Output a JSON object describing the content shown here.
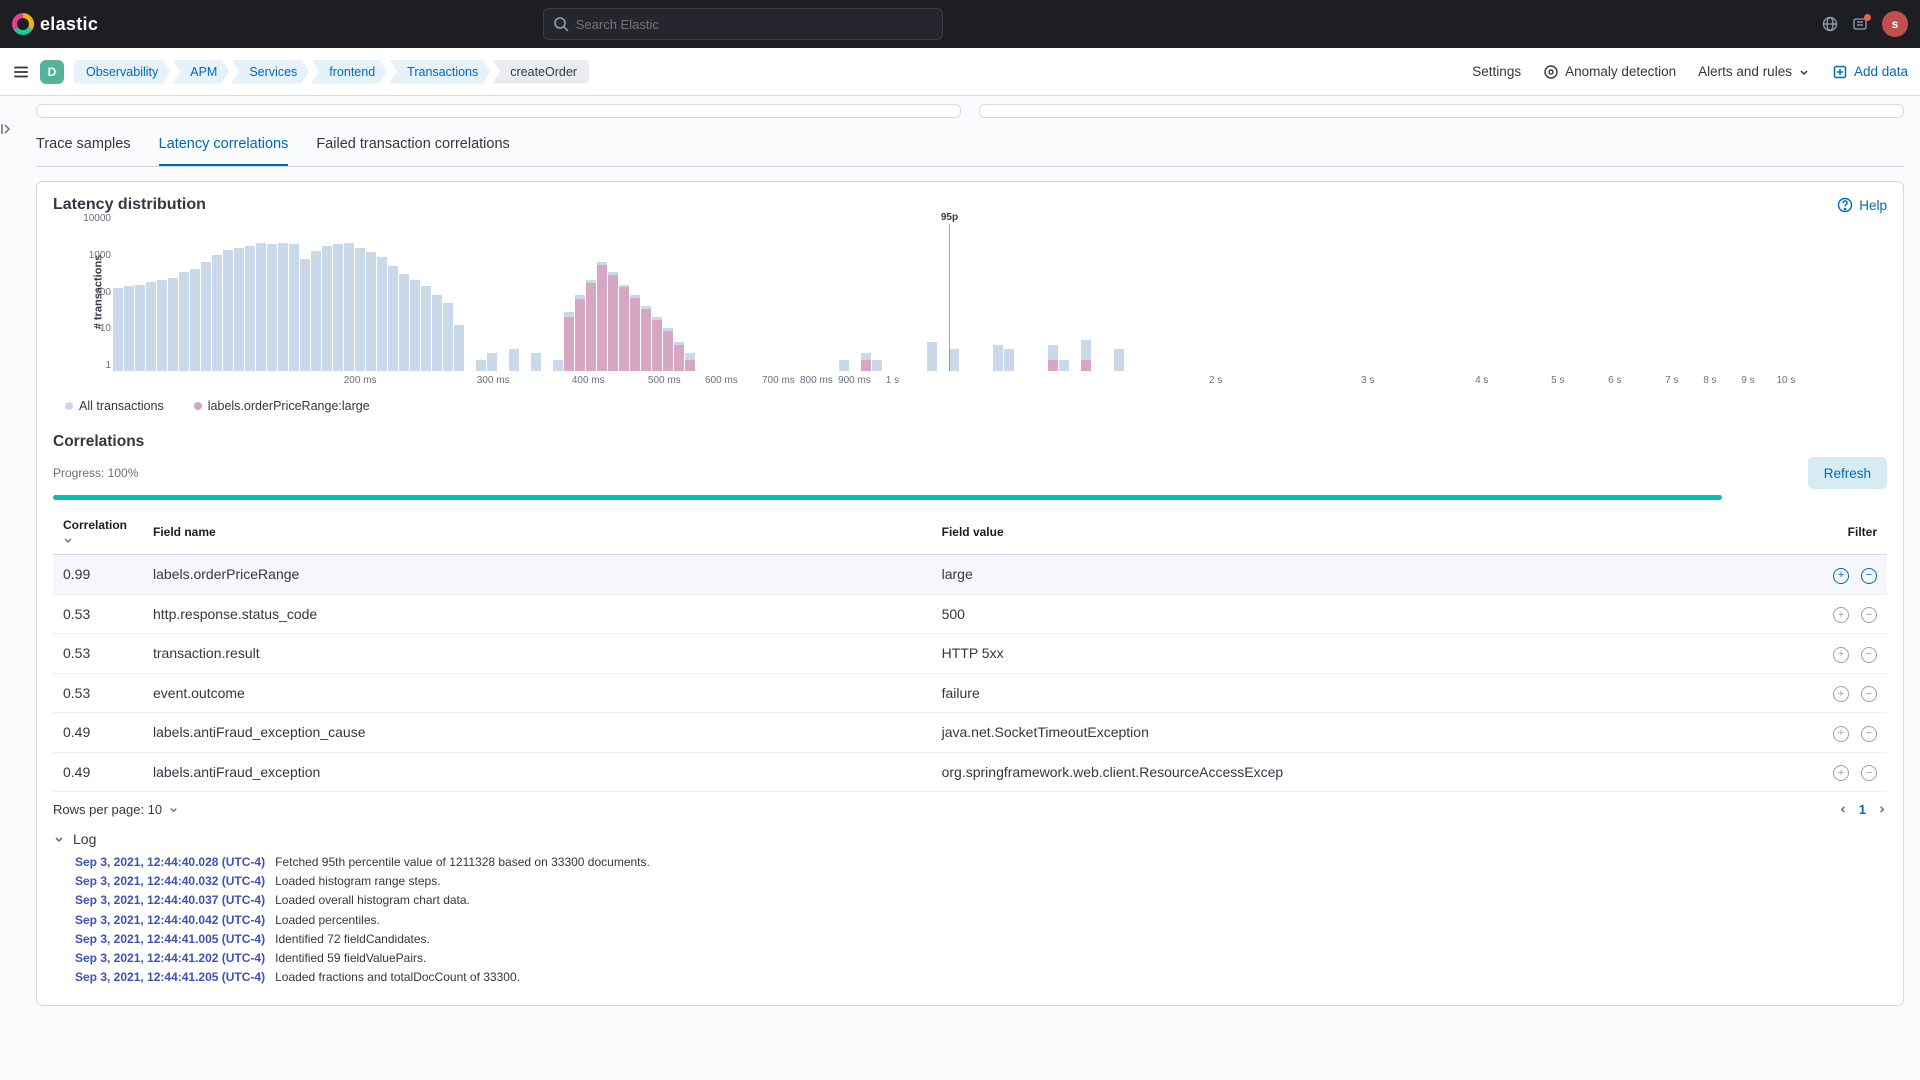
{
  "brand": "elastic",
  "search_placeholder": "Search Elastic",
  "avatar_initial": "s",
  "breadcrumbs": [
    "Observability",
    "APM",
    "Services",
    "frontend",
    "Transactions",
    "createOrder"
  ],
  "subnav": {
    "settings": "Settings",
    "anomaly": "Anomaly detection",
    "alerts": "Alerts and rules",
    "add": "Add data"
  },
  "tabs": {
    "samples": "Trace samples",
    "latency": "Latency correlations",
    "failed": "Failed transaction correlations"
  },
  "panel": {
    "title": "Latency distribution",
    "help": "Help",
    "p95": "95p"
  },
  "legend": {
    "all": "All transactions",
    "sel": "labels.orderPriceRange:large",
    "all_color": "#c9d9ea",
    "sel_color": "#d6a6c2"
  },
  "chart_data": {
    "type": "bar",
    "xlabel": "",
    "ylabel": "# transactions",
    "yticks": [
      "1",
      "10",
      "100",
      "1000",
      "10000"
    ],
    "ylim": [
      1,
      10000
    ],
    "p95_index": 44,
    "xticks": [
      {
        "pos": 13,
        "label": "200 ms"
      },
      {
        "pos": 20,
        "label": "300 ms"
      },
      {
        "pos": 25,
        "label": "400 ms"
      },
      {
        "pos": 29,
        "label": "500 ms"
      },
      {
        "pos": 32,
        "label": "600 ms"
      },
      {
        "pos": 35,
        "label": "700 ms"
      },
      {
        "pos": 37,
        "label": "800 ms"
      },
      {
        "pos": 39,
        "label": "900 ms"
      },
      {
        "pos": 41,
        "label": "1 s"
      },
      {
        "pos": 58,
        "label": "2 s"
      },
      {
        "pos": 66,
        "label": "3 s"
      },
      {
        "pos": 72,
        "label": "4 s"
      },
      {
        "pos": 76,
        "label": "5 s"
      },
      {
        "pos": 79,
        "label": "6 s"
      },
      {
        "pos": 82,
        "label": "7 s"
      },
      {
        "pos": 84,
        "label": "8 s"
      },
      {
        "pos": 86,
        "label": "9 s"
      },
      {
        "pos": 88,
        "label": "10 s"
      }
    ],
    "series": [
      {
        "name": "All transactions",
        "color": "#c9d9ea",
        "values": [
          180,
          200,
          220,
          260,
          300,
          350,
          480,
          600,
          900,
          1400,
          2000,
          2200,
          2600,
          3000,
          2900,
          3100,
          2800,
          1100,
          1800,
          2500,
          2800,
          3000,
          2200,
          1700,
          1300,
          700,
          450,
          300,
          200,
          120,
          70,
          18,
          0,
          2,
          3,
          0,
          4,
          0,
          3,
          0,
          2,
          40,
          120,
          300,
          900,
          500,
          220,
          120,
          60,
          30,
          15,
          6,
          3,
          0,
          0,
          0,
          0,
          0,
          0,
          0,
          0,
          0,
          0,
          0,
          0,
          1,
          2,
          0,
          3,
          2,
          0,
          0,
          0,
          0,
          6,
          0,
          4,
          0,
          0,
          0,
          5,
          4,
          0,
          0,
          0,
          5,
          2,
          0,
          7,
          0,
          0,
          4,
          0
        ]
      },
      {
        "name": "labels.orderPriceRange:large",
        "color": "#d6a6c2",
        "values": [
          0,
          0,
          0,
          0,
          0,
          0,
          0,
          0,
          0,
          0,
          0,
          0,
          0,
          0,
          0,
          0,
          0,
          0,
          0,
          0,
          0,
          0,
          0,
          0,
          0,
          0,
          0,
          0,
          0,
          0,
          0,
          0,
          0,
          0,
          0,
          0,
          0,
          0,
          0,
          0,
          0,
          30,
          90,
          250,
          750,
          420,
          190,
          100,
          50,
          24,
          12,
          5,
          2,
          0,
          0,
          0,
          0,
          0,
          0,
          0,
          0,
          0,
          0,
          0,
          0,
          0,
          1,
          0,
          2,
          1,
          0,
          0,
          0,
          0,
          0,
          0,
          0,
          0,
          0,
          0,
          0,
          0,
          0,
          0,
          0,
          2,
          0,
          0,
          2,
          0,
          0,
          0,
          0
        ]
      }
    ]
  },
  "correlations": {
    "title": "Correlations",
    "progress_label": "Progress: 100%",
    "refresh": "Refresh",
    "columns": {
      "corr": "Correlation",
      "field": "Field name",
      "value": "Field value",
      "filter": "Filter"
    },
    "rows": [
      {
        "corr": "0.99",
        "field": "labels.orderPriceRange",
        "value": "large",
        "selected": true
      },
      {
        "corr": "0.53",
        "field": "http.response.status_code",
        "value": "500"
      },
      {
        "corr": "0.53",
        "field": "transaction.result",
        "value": "HTTP 5xx"
      },
      {
        "corr": "0.53",
        "field": "event.outcome",
        "value": "failure"
      },
      {
        "corr": "0.49",
        "field": "labels.antiFraud_exception_cause",
        "value": "java.net.SocketTimeoutException"
      },
      {
        "corr": "0.49",
        "field": "labels.antiFraud_exception",
        "value": "org.springframework.web.client.ResourceAccessExcep"
      }
    ],
    "rows_pp_label": "Rows per page: 10",
    "page": "1"
  },
  "log": {
    "title": "Log",
    "lines": [
      {
        "ts": "Sep 3, 2021, 12:44:40.028 (UTC-4)",
        "msg": "Fetched 95th percentile value of 1211328 based on 33300 documents."
      },
      {
        "ts": "Sep 3, 2021, 12:44:40.032 (UTC-4)",
        "msg": "Loaded histogram range steps."
      },
      {
        "ts": "Sep 3, 2021, 12:44:40.037 (UTC-4)",
        "msg": "Loaded overall histogram chart data."
      },
      {
        "ts": "Sep 3, 2021, 12:44:40.042 (UTC-4)",
        "msg": "Loaded percentiles."
      },
      {
        "ts": "Sep 3, 2021, 12:44:41.005 (UTC-4)",
        "msg": "Identified 72 fieldCandidates."
      },
      {
        "ts": "Sep 3, 2021, 12:44:41.202 (UTC-4)",
        "msg": "Identified 59 fieldValuePairs."
      },
      {
        "ts": "Sep 3, 2021, 12:44:41.205 (UTC-4)",
        "msg": "Loaded fractions and totalDocCount of 33300."
      }
    ]
  }
}
